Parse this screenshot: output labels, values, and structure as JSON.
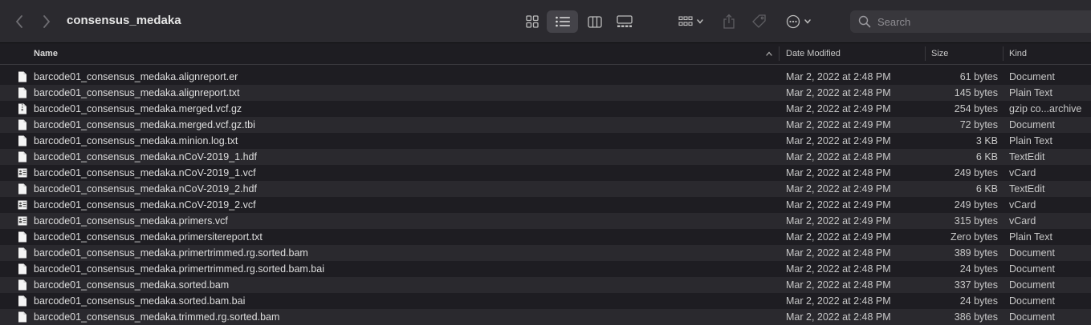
{
  "window": {
    "title": "consensus_medaka"
  },
  "toolbar": {
    "back_icon": "chevron-left-icon",
    "forward_icon": "chevron-right-icon",
    "view_modes": [
      "icon-view",
      "list-view",
      "column-view",
      "gallery-view"
    ],
    "selected_view": "list-view"
  },
  "search": {
    "placeholder": "Search"
  },
  "columns": {
    "name": "Name",
    "date": "Date Modified",
    "size": "Size",
    "kind": "Kind"
  },
  "files": [
    {
      "name": "barcode01_consensus_medaka.alignreport.er",
      "date": "Mar 2, 2022 at 2:48 PM",
      "size": "61 bytes",
      "kind": "Document",
      "icon": "document-icon"
    },
    {
      "name": "barcode01_consensus_medaka.alignreport.txt",
      "date": "Mar 2, 2022 at 2:48 PM",
      "size": "145 bytes",
      "kind": "Plain Text",
      "icon": "document-icon"
    },
    {
      "name": "barcode01_consensus_medaka.merged.vcf.gz",
      "date": "Mar 2, 2022 at 2:49 PM",
      "size": "254 bytes",
      "kind": "gzip co...archive",
      "icon": "archive-icon"
    },
    {
      "name": "barcode01_consensus_medaka.merged.vcf.gz.tbi",
      "date": "Mar 2, 2022 at 2:49 PM",
      "size": "72 bytes",
      "kind": "Document",
      "icon": "document-icon"
    },
    {
      "name": "barcode01_consensus_medaka.minion.log.txt",
      "date": "Mar 2, 2022 at 2:49 PM",
      "size": "3 KB",
      "kind": "Plain Text",
      "icon": "document-icon"
    },
    {
      "name": "barcode01_consensus_medaka.nCoV-2019_1.hdf",
      "date": "Mar 2, 2022 at 2:48 PM",
      "size": "6 KB",
      "kind": "TextEdit",
      "icon": "document-icon"
    },
    {
      "name": "barcode01_consensus_medaka.nCoV-2019_1.vcf",
      "date": "Mar 2, 2022 at 2:48 PM",
      "size": "249 bytes",
      "kind": "vCard",
      "icon": "vcard-icon"
    },
    {
      "name": "barcode01_consensus_medaka.nCoV-2019_2.hdf",
      "date": "Mar 2, 2022 at 2:49 PM",
      "size": "6 KB",
      "kind": "TextEdit",
      "icon": "document-icon"
    },
    {
      "name": "barcode01_consensus_medaka.nCoV-2019_2.vcf",
      "date": "Mar 2, 2022 at 2:49 PM",
      "size": "249 bytes",
      "kind": "vCard",
      "icon": "vcard-icon"
    },
    {
      "name": "barcode01_consensus_medaka.primers.vcf",
      "date": "Mar 2, 2022 at 2:49 PM",
      "size": "315 bytes",
      "kind": "vCard",
      "icon": "vcard-icon"
    },
    {
      "name": "barcode01_consensus_medaka.primersitereport.txt",
      "date": "Mar 2, 2022 at 2:49 PM",
      "size": "Zero bytes",
      "kind": "Plain Text",
      "icon": "document-icon"
    },
    {
      "name": "barcode01_consensus_medaka.primertrimmed.rg.sorted.bam",
      "date": "Mar 2, 2022 at 2:48 PM",
      "size": "389 bytes",
      "kind": "Document",
      "icon": "document-icon"
    },
    {
      "name": "barcode01_consensus_medaka.primertrimmed.rg.sorted.bam.bai",
      "date": "Mar 2, 2022 at 2:48 PM",
      "size": "24 bytes",
      "kind": "Document",
      "icon": "document-icon"
    },
    {
      "name": "barcode01_consensus_medaka.sorted.bam",
      "date": "Mar 2, 2022 at 2:48 PM",
      "size": "337 bytes",
      "kind": "Document",
      "icon": "document-icon"
    },
    {
      "name": "barcode01_consensus_medaka.sorted.bam.bai",
      "date": "Mar 2, 2022 at 2:48 PM",
      "size": "24 bytes",
      "kind": "Document",
      "icon": "document-icon"
    },
    {
      "name": "barcode01_consensus_medaka.trimmed.rg.sorted.bam",
      "date": "Mar 2, 2022 at 2:48 PM",
      "size": "386 bytes",
      "kind": "Document",
      "icon": "document-icon"
    }
  ]
}
